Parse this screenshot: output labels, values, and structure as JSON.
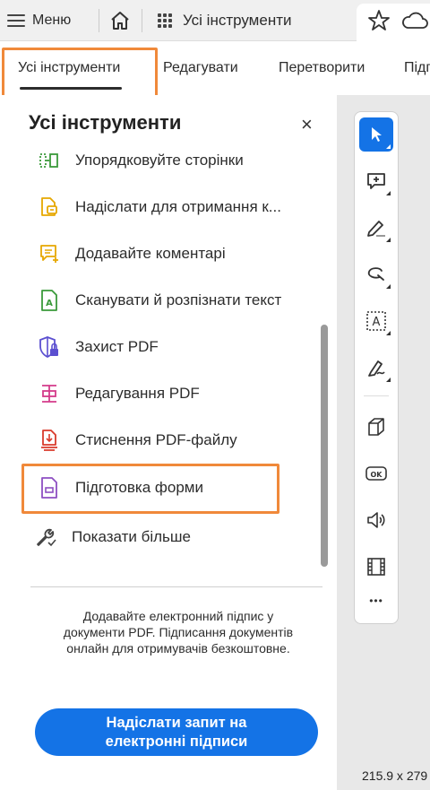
{
  "topbar": {
    "menu_label": "Меню",
    "tools_label": "Усі інструменти"
  },
  "tabs": [
    {
      "label": "Усі інструменти",
      "active": true
    },
    {
      "label": "Редагувати"
    },
    {
      "label": "Перетворити"
    },
    {
      "label": "Підп"
    }
  ],
  "panel": {
    "title": "Усі інструменти",
    "close_symbol": "×",
    "items": [
      {
        "label": "Упорядковуйте сторінки",
        "icon": "organize-pages-icon",
        "color": "#3a9a3a"
      },
      {
        "label": "Надіслати для отримання к...",
        "icon": "send-for-comments-icon",
        "color": "#e6a700"
      },
      {
        "label": "Додавайте коментарі",
        "icon": "comment-icon",
        "color": "#e6a700"
      },
      {
        "label": "Сканувати й розпізнати текст",
        "icon": "scan-ocr-icon",
        "color": "#3a9a3a"
      },
      {
        "label": "Захист PDF",
        "icon": "protect-pdf-icon",
        "color": "#5b4fd0"
      },
      {
        "label": "Редагування PDF",
        "icon": "edit-pdf-icon",
        "color": "#d43b8b"
      },
      {
        "label": "Стиснення PDF-файлу",
        "icon": "compress-pdf-icon",
        "color": "#d93a2b"
      },
      {
        "label": "Підготовка форми",
        "icon": "prepare-form-icon",
        "color": "#8d4fc2"
      },
      {
        "label": "Показати більше",
        "icon": "tools-more-icon",
        "color": "#444444"
      }
    ],
    "promo_text": "Додавайте електронний підпис у документи PDF. Підписання документів\nонлайн для отримувачів безкоштовне.",
    "cta_label": "Надіслати запит на\nелектронні підписи"
  },
  "quick_tools": [
    "select-tool-icon",
    "add-comment-icon",
    "highlight-pen-icon",
    "lasso-draw-icon",
    "text-recognition-icon",
    "sign-pen-icon",
    "3d-box-icon",
    "ok-button-icon",
    "sound-icon",
    "video-film-icon",
    "more-options-icon"
  ],
  "more_symbol": "•••",
  "page_size": "215.9 x 279",
  "colors": {
    "accent": "#1473e6",
    "highlight": "#f0893a"
  }
}
